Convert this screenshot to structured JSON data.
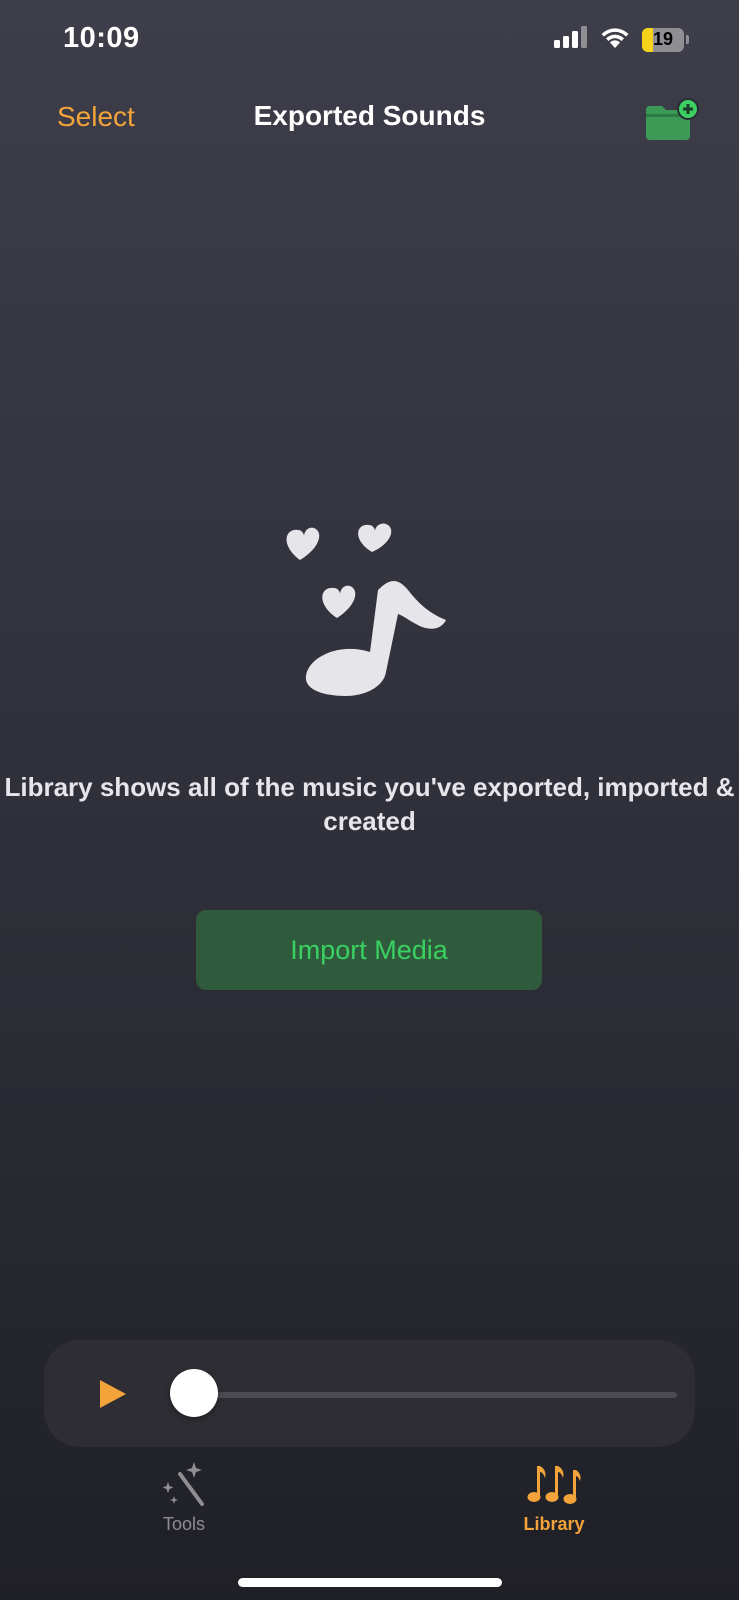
{
  "status_bar": {
    "time": "10:09",
    "battery_level": "19"
  },
  "nav": {
    "select_label": "Select",
    "title": "Exported Sounds",
    "new_folder_icon": "folder-plus-icon"
  },
  "empty_state": {
    "icon": "music-note-hearts-icon",
    "message": "Library shows all of the music you've exported, imported & created",
    "import_button_label": "Import Media"
  },
  "player": {
    "play_icon": "play-icon",
    "progress": 0
  },
  "tabs": [
    {
      "label": "Tools",
      "icon": "magic-wand-icon",
      "active": false
    },
    {
      "label": "Library",
      "icon": "music-notes-icon",
      "active": true
    }
  ],
  "colors": {
    "accent": "#f2a43a",
    "green": "#3ad162",
    "green_bg": "#2f5a3c"
  }
}
